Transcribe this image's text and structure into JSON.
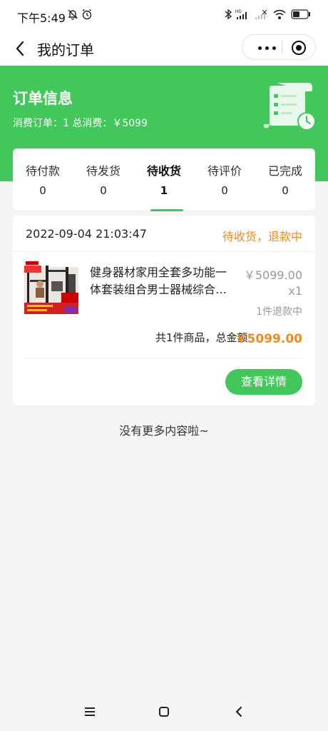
{
  "status_bar": {
    "time": "下午5:49",
    "left_icons": [
      "mute-bell-icon",
      "alarm-icon"
    ],
    "right_icons": [
      "bluetooth-icon",
      "hd-signal-icon",
      "signal-icon",
      "wifi-icon",
      "battery-icon"
    ],
    "battery_level": "36"
  },
  "navbar": {
    "title": "我的订单"
  },
  "header": {
    "title": "订单信息",
    "summary": "消费订单：1 总消费：￥5099"
  },
  "tabs": [
    {
      "label": "待付款",
      "count": "0",
      "active": false
    },
    {
      "label": "待发货",
      "count": "0",
      "active": false
    },
    {
      "label": "待收货",
      "count": "1",
      "active": true
    },
    {
      "label": "待评价",
      "count": "0",
      "active": false
    },
    {
      "label": "已完成",
      "count": "0",
      "active": false
    }
  ],
  "order": {
    "date": "2022-09-04 21:03:47",
    "status": "待收货，退款中",
    "product_name": "健身器材家用全套多功能一体套装组合男士器械综合训练器",
    "price": "￥5099.00",
    "qty": "x1",
    "refund_note": "1件退款中",
    "total_label": "共1件商品，总金额",
    "total_value": "￥5099.00",
    "detail_button": "查看详情"
  },
  "footer_text": "没有更多内容啦~",
  "colors": {
    "accent": "#42c85a",
    "orange": "#f08a1c"
  }
}
